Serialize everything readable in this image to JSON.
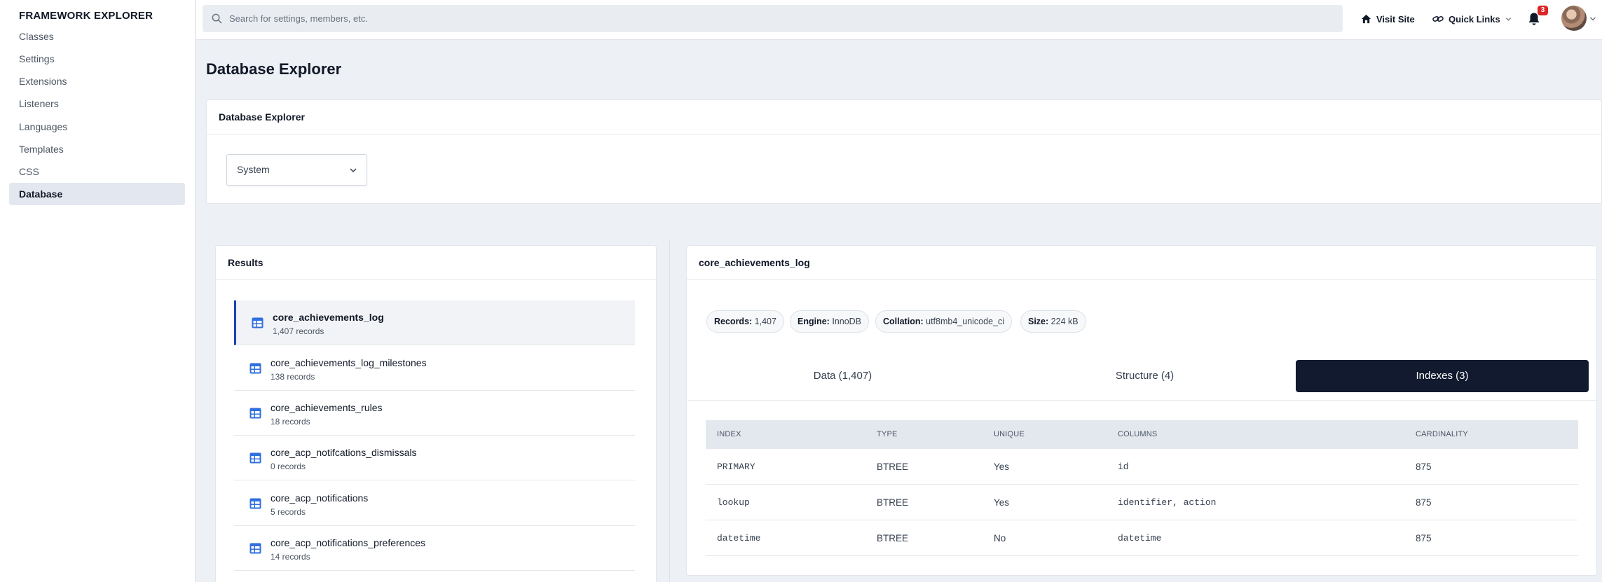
{
  "sidebar": {
    "title": "FRAMEWORK EXPLORER",
    "items": [
      {
        "label": "Classes"
      },
      {
        "label": "Settings"
      },
      {
        "label": "Extensions"
      },
      {
        "label": "Listeners"
      },
      {
        "label": "Languages"
      },
      {
        "label": "Templates"
      },
      {
        "label": "CSS"
      },
      {
        "label": "Database",
        "active": true
      }
    ]
  },
  "topbar": {
    "search_placeholder": "Search for settings, members, etc.",
    "visit_site": "Visit Site",
    "quick_links": "Quick Links",
    "notification_count": "3"
  },
  "page": {
    "title": "Database Explorer"
  },
  "explorer_card": {
    "header": "Database Explorer",
    "select_value": "System"
  },
  "results": {
    "header": "Results",
    "items": [
      {
        "name": "core_achievements_log",
        "count": "1,407 records",
        "active": true
      },
      {
        "name": "core_achievements_log_milestones",
        "count": "138 records"
      },
      {
        "name": "core_achievements_rules",
        "count": "18 records"
      },
      {
        "name": "core_acp_notifcations_dismissals",
        "count": "0 records"
      },
      {
        "name": "core_acp_notifications",
        "count": "5 records"
      },
      {
        "name": "core_acp_notifications_preferences",
        "count": "14 records"
      }
    ]
  },
  "detail": {
    "header": "core_achievements_log",
    "pills": [
      {
        "label": "Records:",
        "value": "1,407"
      },
      {
        "label": "Engine:",
        "value": "InnoDB"
      },
      {
        "label": "Collation:",
        "value": "utf8mb4_unicode_ci"
      },
      {
        "label": "Size:",
        "value": "224 kB"
      }
    ],
    "tabs": [
      {
        "label": "Data (1,407)"
      },
      {
        "label": "Structure (4)"
      },
      {
        "label": "Indexes (3)",
        "active": true
      }
    ],
    "table": {
      "columns": [
        "INDEX",
        "TYPE",
        "UNIQUE",
        "COLUMNS",
        "CARDINALITY"
      ],
      "rows": [
        [
          "PRIMARY",
          "BTREE",
          "Yes",
          "id",
          "875"
        ],
        [
          "lookup",
          "BTREE",
          "Yes",
          "identifier, action",
          "875"
        ],
        [
          "datetime",
          "BTREE",
          "No",
          "datetime",
          "875"
        ]
      ]
    }
  },
  "colors": {
    "accent": "#1e40af",
    "icon_blue": "#2f6fdf",
    "active_tab_bg": "#111a2e",
    "badge": "#dc2626"
  }
}
